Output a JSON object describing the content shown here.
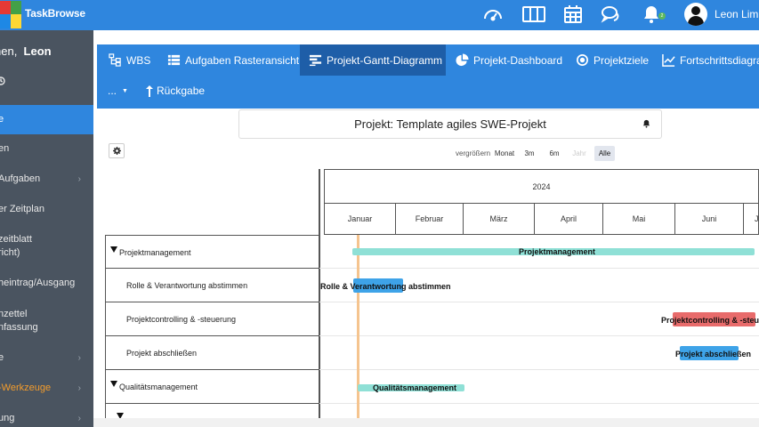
{
  "app": {
    "brand": "TaskBrowse",
    "user_name": "Leon Limb"
  },
  "topbar_icons": [
    "dashboard-icon",
    "columns-icon",
    "calendar-icon",
    "chat-icon",
    "bell-icon"
  ],
  "notification_count": "2",
  "sidebar": {
    "greeting_prefix": "nen,",
    "greeting_name": "Leon",
    "items": [
      {
        "label": "",
        "icon": "clock-icon"
      },
      {
        "label": "e",
        "active": true
      },
      {
        "label": "en"
      },
      {
        "label": "Aufgaben",
        "chevron": "›"
      },
      {
        "label": "er Zeitplan"
      },
      {
        "label": "zeitblatt",
        "label2": "richt)"
      },
      {
        "label": "heintrag/Ausgang"
      },
      {
        "label": "nzettel",
        "label2": "nfassung"
      },
      {
        "label": "e",
        "chevron": "›"
      },
      {
        "label": "-Werkzeuge",
        "chevron": "›",
        "highlight": true
      },
      {
        "label": "ung",
        "chevron": "›"
      }
    ]
  },
  "tabs": [
    {
      "label": "WBS",
      "icon": "sitemap-icon"
    },
    {
      "label": "Aufgaben Rasteransicht",
      "icon": "list-icon"
    },
    {
      "label": "Projekt-Gantt-Diagramm",
      "icon": "gantt-icon",
      "active": true
    },
    {
      "label": "Projekt-Dashboard",
      "icon": "pie-chart-icon"
    },
    {
      "label": "Projektziele",
      "icon": "target-icon"
    },
    {
      "label": "Fortschrittsdiagra",
      "icon": "line-chart-icon"
    }
  ],
  "tabs_row2": {
    "more_label": "...",
    "back_label": "Rückgabe"
  },
  "project_title": "Projekt: Template agiles SWE-Projekt",
  "zoom": {
    "label": "vergrößern",
    "options": [
      "Monat",
      "3m",
      "6m",
      "Jahr",
      "Alle"
    ],
    "selected": "Alle",
    "disabled": "Jahr"
  },
  "gantt": {
    "year": "2024",
    "months": [
      "Januar",
      "Februar",
      "März",
      "April",
      "Mai",
      "Juni",
      "J"
    ],
    "tasks": [
      {
        "name": "Projektmanagement",
        "group": true
      },
      {
        "name": "Rolle & Verantwortung abstimmen"
      },
      {
        "name": "Projektcontrolling & -steuerung"
      },
      {
        "name": "Projekt abschließen"
      },
      {
        "name": "Qualitätsmanagement",
        "group": true
      }
    ],
    "bar_labels": {
      "projektmanagement": "Projektmanagement",
      "rolle": "Rolle & Verantwortung abstimmen",
      "controlling": "Projektcontrolling & -steueru",
      "abschliessen": "Projekt abschließen",
      "qualitaet": "Qualitätsmanagement"
    },
    "colors": {
      "group": "#8fe0d6",
      "task": "#3ea3e8",
      "late": "#e86b6b",
      "today": "#f5c48f"
    }
  }
}
